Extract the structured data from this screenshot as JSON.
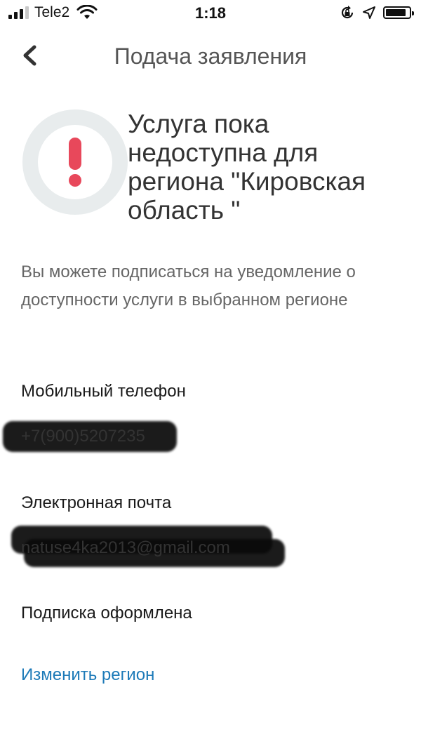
{
  "status_bar": {
    "carrier": "Tele2",
    "time": "1:18",
    "icons": [
      "signal-icon",
      "wifi-icon",
      "orientation-lock-icon",
      "location-icon",
      "battery-icon"
    ]
  },
  "nav": {
    "back_icon": "chevron-left-icon",
    "title": "Подача заявления"
  },
  "alert": {
    "icon": "exclamation-icon",
    "accent_color": "#e8485b",
    "ring_color": "#e8eced",
    "lines": [
      "Услуга пока",
      "недоступна для",
      "региона \"Кировская",
      "область \""
    ]
  },
  "info_text": "Вы можете подписаться на уведомление о доступности услуги в выбранном регионе",
  "fields": {
    "phone_label": "Мобильный телефон",
    "phone_value": "+7(900)5207235",
    "email_label": "Электронная почта",
    "email_value": "natuse4ka2013@gmail.com"
  },
  "subscription_status": "Подписка оформлена",
  "change_region_link": "Изменить регион",
  "link_color": "#1d7ab8"
}
